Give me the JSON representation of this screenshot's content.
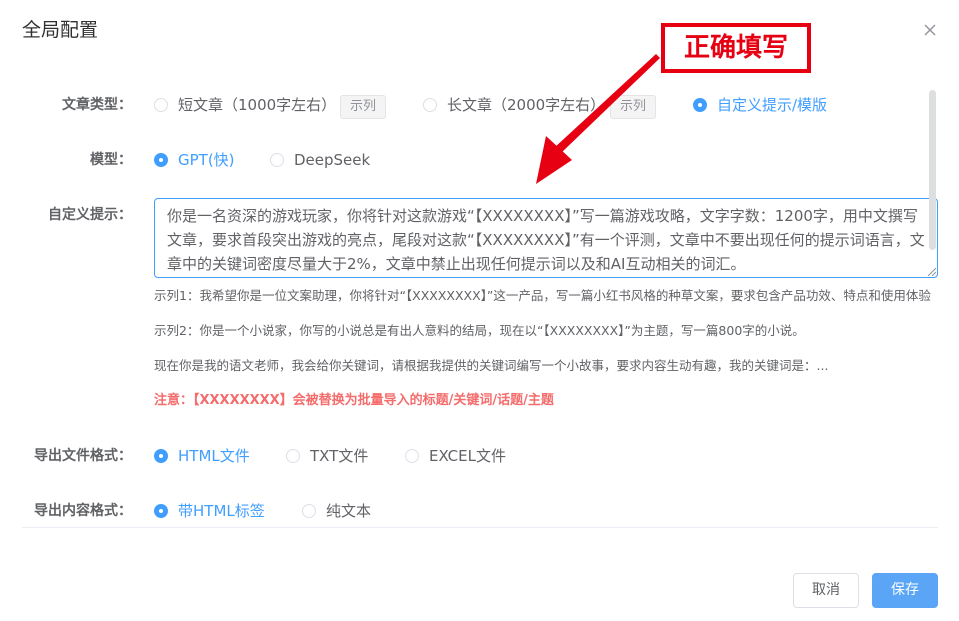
{
  "dialog": {
    "title": "全局配置"
  },
  "article_type": {
    "label": "文章类型：",
    "options": [
      {
        "label": "短文章（1000字左右）",
        "checked": false,
        "example": "示列"
      },
      {
        "label": "长文章（2000字左右）",
        "checked": false,
        "example": "示列"
      },
      {
        "label": "自定义提示/模版",
        "checked": true
      }
    ]
  },
  "model": {
    "label": "模型：",
    "options": [
      {
        "label": "GPT(快)",
        "checked": true
      },
      {
        "label": "DeepSeek",
        "checked": false
      }
    ]
  },
  "custom_prompt": {
    "label": "自定义提示：",
    "value": "你是一名资深的游戏玩家，你将针对这款游戏“【XXXXXXXX】”写一篇游戏攻略，文字字数：1200字，用中文撰写文章，要求首段突出游戏的亮点，尾段对这款“【XXXXXXXX】”有一个评测，文章中不要出现任何的提示词语言，文章中的关键词密度尽量大于2%，文章中禁止出现任何提示词以及和AI互动相关的词汇。",
    "examples": [
      "示列1：我希望你是一位文案助理，你将针对“【XXXXXXXX】”这一产品，写一篇小红书风格的种草文案，要求包含产品功效、特点和使用体验",
      "示列2：你是一个小说家，你写的小说总是有出人意料的结局，现在以“【XXXXXXXX】”为主题，写一篇800字的小说。",
      "现在你是我的语文老师，我会给你关键词，请根据我提供的关键词编写一个小故事，要求内容生动有趣，我的关键词是：..."
    ],
    "note": "注意：【XXXXXXXX】会被替换为批量导入的标题/关键词/话题/主题"
  },
  "export_format": {
    "label": "导出文件格式：",
    "options": [
      {
        "label": "HTML文件",
        "checked": true
      },
      {
        "label": "TXT文件",
        "checked": false
      },
      {
        "label": "EXCEL文件",
        "checked": false
      }
    ]
  },
  "content_format": {
    "label": "导出内容格式：",
    "options": [
      {
        "label": "带HTML标签",
        "checked": true
      },
      {
        "label": "纯文本",
        "checked": false
      }
    ]
  },
  "footer": {
    "cancel_label": "取消",
    "save_label": "保存"
  },
  "annotation": {
    "text": "正确填写",
    "color": "#e60012"
  },
  "colors": {
    "primary": "#409eff",
    "danger": "#f56c6c",
    "save_button": "#5aa5f5"
  }
}
